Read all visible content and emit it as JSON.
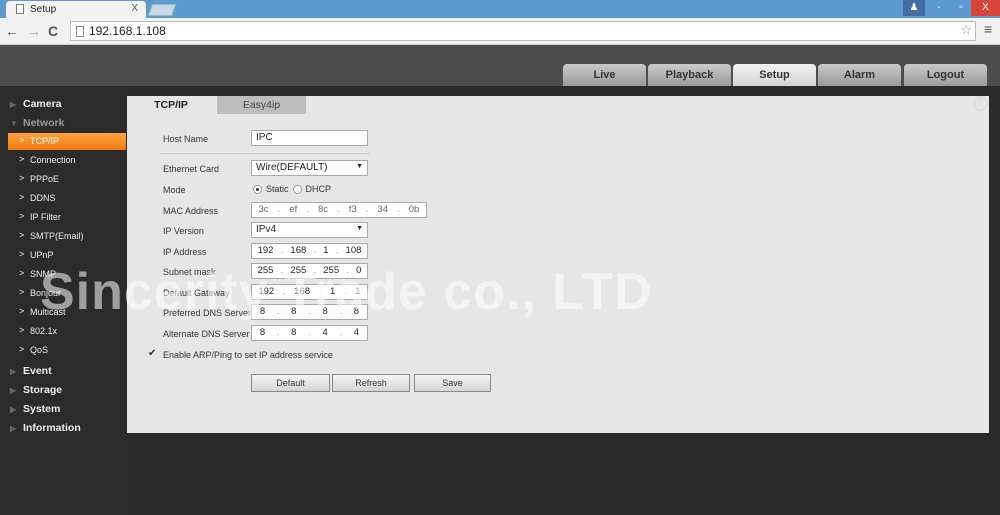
{
  "browser": {
    "tab_title": "Setup",
    "tab_close": "X",
    "url": "192.168.1.108",
    "window_buttons": [
      "-",
      "▫",
      "X"
    ]
  },
  "topnav": {
    "items": [
      "Live",
      "Playback",
      "Setup",
      "Alarm",
      "Logout"
    ],
    "active": "Setup"
  },
  "sidebar": {
    "sections_top": [
      "Camera",
      "Network"
    ],
    "network_items": [
      "TCP/IP",
      "Connection",
      "PPPoE",
      "DDNS",
      "IP Filter",
      "SMTP(Email)",
      "UPnP",
      "SNMP",
      "Bonjour",
      "Multicast",
      "802.1x",
      "QoS"
    ],
    "active_item": "TCP/IP",
    "sections_bottom": [
      "Event",
      "Storage",
      "System",
      "Information"
    ]
  },
  "tabs": [
    "TCP/IP",
    "Easy4ip"
  ],
  "help": "?",
  "form": {
    "host_name_label": "Host Name",
    "host_name": "IPC",
    "ethernet_card_label": "Ethernet Card",
    "ethernet_card": "Wire(DEFAULT)",
    "mode_label": "Mode",
    "mode_static": "Static",
    "mode_dhcp": "DHCP",
    "mode_selected": "Static",
    "mac_label": "MAC Address",
    "mac": [
      "3c",
      "ef",
      "8c",
      "f3",
      "34",
      "0b"
    ],
    "ip_version_label": "IP Version",
    "ip_version": "IPv4",
    "ip_label": "IP Address",
    "ip": [
      "192",
      "168",
      "1",
      "108"
    ],
    "subnet_label": "Subnet mask",
    "subnet": [
      "255",
      "255",
      "255",
      "0"
    ],
    "gateway_label": "Default Gateway",
    "gateway": [
      "192",
      "168",
      "1",
      "1"
    ],
    "dns1_label": "Preferred DNS Server",
    "dns1": [
      "8",
      "8",
      "8",
      "8"
    ],
    "dns2_label": "Alternate DNS Server",
    "dns2": [
      "8",
      "8",
      "4",
      "4"
    ],
    "arp_label": "Enable ARP/Ping to set IP address service",
    "arp_checked": true
  },
  "buttons": {
    "default": "Default",
    "refresh": "Refresh",
    "save": "Save"
  },
  "watermark": "Sincerity Trade co., LTD",
  "colors": {
    "accent": "#f5861a",
    "browser_bar": "#5e9ad2"
  }
}
